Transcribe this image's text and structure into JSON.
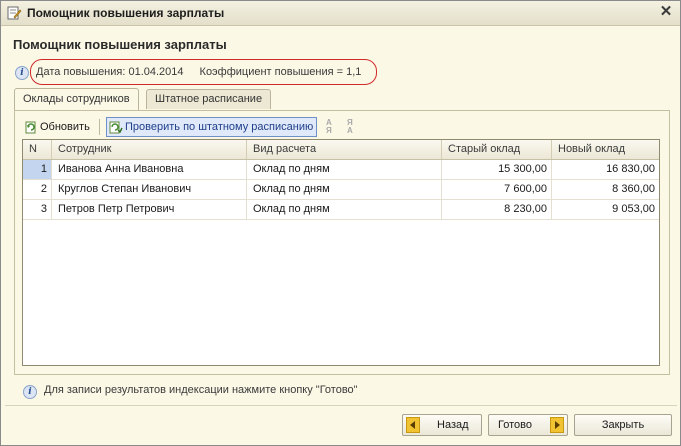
{
  "window": {
    "title": "Помощник повышения зарплаты",
    "close_icon": "close-icon"
  },
  "heading": "Помощник повышения зарплаты",
  "info": {
    "date_text": "Дата повышения: 01.04.2014",
    "coef_text": "Коэффициент повышения = 1,1"
  },
  "tabs": [
    {
      "label": "Оклады сотрудников",
      "active": true
    },
    {
      "label": "Штатное расписание",
      "active": false
    }
  ],
  "toolbar": {
    "refresh_label": "Обновить",
    "check_label": "Проверить по штатному расписанию"
  },
  "table": {
    "columns": [
      "N",
      "Сотрудник",
      "Вид расчета",
      "Старый оклад",
      "Новый оклад"
    ],
    "rows": [
      [
        "1",
        "Иванова Анна Ивановна",
        "Оклад по дням",
        "15 300,00",
        "16 830,00"
      ],
      [
        "2",
        "Круглов Степан Иванович",
        "Оклад по дням",
        "7 600,00",
        "8 360,00"
      ],
      [
        "3",
        "Петров Петр Петрович",
        "Оклад по дням",
        "8 230,00",
        "9 053,00"
      ]
    ]
  },
  "bottom_info": "Для записи результатов индексации нажмите кнопку \"Готово\"",
  "buttons": {
    "back": "Назад",
    "done": "Готово",
    "close": "Закрыть"
  },
  "colors": {
    "window_bg": "#fbf8e6",
    "selection": "#c4d6ef",
    "highlight_oval": "#d12a2a",
    "nav_arrow": "#f1c232"
  }
}
